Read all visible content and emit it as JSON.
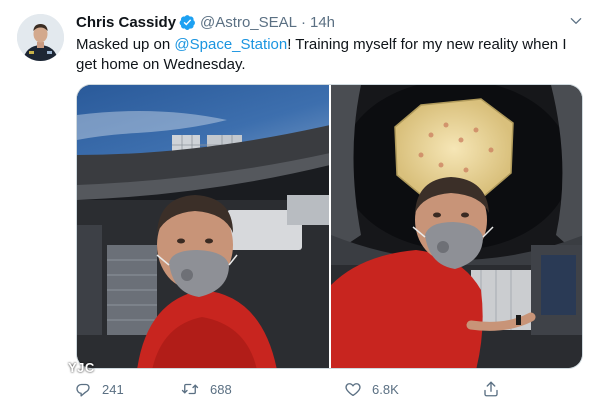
{
  "tweet": {
    "author": {
      "name": "Chris Cassidy",
      "handle": "@Astro_SEAL",
      "verified": true
    },
    "time": "14h",
    "separator": "·",
    "text_parts": {
      "before": "Masked up on ",
      "mention": "@Space_Station",
      "after": "! Training myself for my new reality when I get home on Wednesday."
    },
    "media": [
      {
        "name": "cupola-selfie-left",
        "description": "astronaut in red shirt wearing grey mask in cupola, Earth and solar arrays behind"
      },
      {
        "name": "cupola-selfie-right",
        "description": "astronaut in red shirt wearing grey mask in cupola, docked vehicle overhead"
      }
    ],
    "actions": {
      "reply_count": "241",
      "retweet_count": "688",
      "like_count": "6.8K"
    }
  },
  "watermark": {
    "text": "YJC"
  },
  "colors": {
    "accent": "#1b95e0",
    "secondary_text": "#5b7083",
    "verified": "#1da1f2"
  },
  "icons": [
    "verified-badge-icon",
    "caret-down-icon",
    "reply-icon",
    "retweet-icon",
    "like-icon",
    "share-icon"
  ]
}
